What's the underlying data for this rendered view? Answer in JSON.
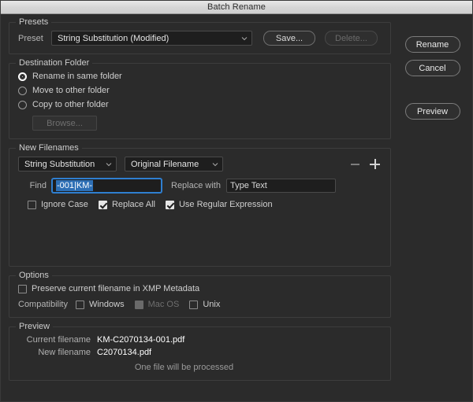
{
  "window": {
    "title": "Batch Rename"
  },
  "presets": {
    "group_title": "Presets",
    "preset_label": "Preset",
    "preset_value": "String Substitution (Modified)",
    "save_label": "Save...",
    "delete_label": "Delete..."
  },
  "destination": {
    "group_title": "Destination Folder",
    "options": [
      {
        "label": "Rename in same folder",
        "selected": true
      },
      {
        "label": "Move to other folder",
        "selected": false
      },
      {
        "label": "Copy to other folder",
        "selected": false
      }
    ],
    "browse_label": "Browse..."
  },
  "new_filenames": {
    "group_title": "New Filenames",
    "method_value": "String Substitution",
    "source_value": "Original Filename",
    "remove_icon": "minus-icon",
    "add_icon": "plus-icon",
    "find_label": "Find",
    "find_value": "-001|KM-",
    "replace_label": "Replace with",
    "replace_value": "Type Text",
    "ignore_case_label": "Ignore Case",
    "replace_all_label": "Replace All",
    "regex_label": "Use Regular Expression"
  },
  "options": {
    "group_title": "Options",
    "preserve_label": "Preserve current filename in XMP Metadata",
    "compatibility_label": "Compatibility",
    "windows_label": "Windows",
    "macos_label": "Mac OS",
    "unix_label": "Unix"
  },
  "preview": {
    "group_title": "Preview",
    "current_label": "Current filename",
    "current_value": "KM-C2070134-001.pdf",
    "new_label": "New filename",
    "new_value": "C2070134.pdf",
    "note": "One file will be processed"
  },
  "actions": {
    "rename_label": "Rename",
    "cancel_label": "Cancel",
    "preview_label": "Preview"
  },
  "colors": {
    "background": "#2b2b2b",
    "selection": "#2d6fb5",
    "focus": "#2f7fd0"
  }
}
